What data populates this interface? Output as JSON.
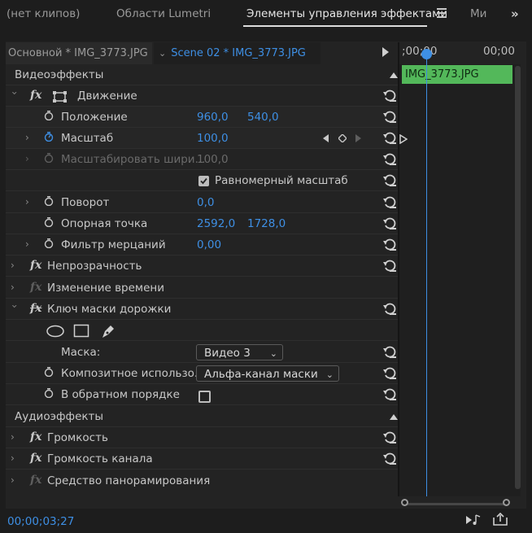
{
  "tabs": [
    {
      "label": "(нет клипов)",
      "active": false
    },
    {
      "label": "Области Lumetri",
      "active": false
    },
    {
      "label": "Элементы управления эффектами",
      "active": true
    },
    {
      "label": "Ми",
      "active": false
    }
  ],
  "clip_header": {
    "master": "Основной * IMG_3773.JPG",
    "scene": "Scene 02 * IMG_3773.JPG"
  },
  "timeline": {
    "timecode_start": ";00;00",
    "timecode_end": "00;00",
    "clip_name": "IMG_3773.JPG"
  },
  "video_effects": {
    "title": "Видеоэффекты",
    "motion": {
      "label": "Движение",
      "position": {
        "label": "Положение",
        "x": "960,0",
        "y": "540,0"
      },
      "scale": {
        "label": "Масштаб",
        "value": "100,0"
      },
      "scale_width": {
        "label": "Масштабировать шири...",
        "value": "100,0"
      },
      "uniform_scale": {
        "label": "Равномерный масштаб",
        "checked": true
      },
      "rotation": {
        "label": "Поворот",
        "value": "0,0"
      },
      "anchor": {
        "label": "Опорная точка",
        "x": "2592,0",
        "y": "1728,0"
      },
      "flicker": {
        "label": "Фильтр мерцаний",
        "value": "0,00"
      }
    },
    "opacity": {
      "label": "Непрозрачность"
    },
    "time_remap": {
      "label": "Изменение времени"
    },
    "track_matte": {
      "label": "Ключ маски дорожки",
      "mask_label": "Маска:",
      "mask_value": "Видео 3",
      "composite_label": "Композитное использо...",
      "composite_value": "Альфа-канал маски",
      "reverse_label": "В обратном порядке",
      "reverse_checked": false
    }
  },
  "audio_effects": {
    "title": "Аудиоэффекты",
    "volume": {
      "label": "Громкость"
    },
    "channel_volume": {
      "label": "Громкость канала"
    },
    "panner": {
      "label": "Средство панорамирования"
    }
  },
  "footer": {
    "timecode": "00;00;03;27"
  },
  "colors": {
    "accent": "#3e8fe4",
    "clip": "#53b85a"
  }
}
